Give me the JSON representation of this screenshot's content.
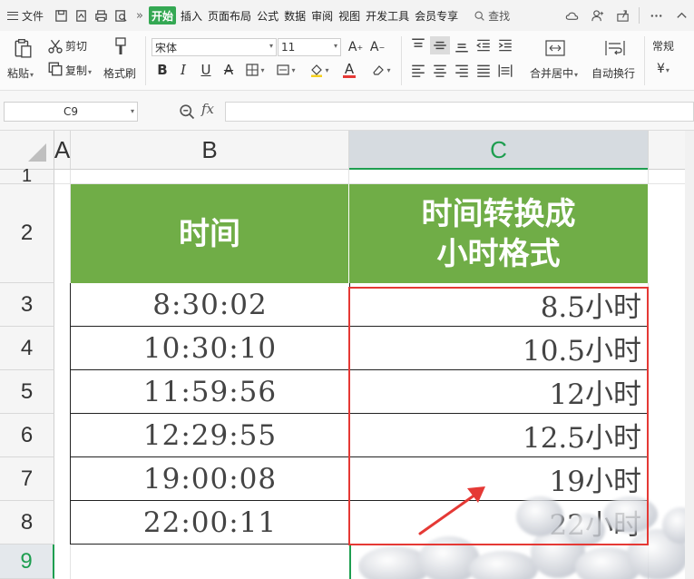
{
  "menubar": {
    "file_label": "文件",
    "tabs": [
      "开始",
      "插入",
      "页面布局",
      "公式",
      "数据",
      "审阅",
      "视图",
      "开发工具",
      "会员专享"
    ],
    "search_label": "查找",
    "more_glyph": "»"
  },
  "ribbon": {
    "paste": "粘贴",
    "cut": "剪切",
    "copy": "复制",
    "format_painter": "格式刷",
    "font_name": "宋体",
    "font_size": "11",
    "merge_center": "合并居中",
    "wrap_text": "自动换行",
    "number_format": "常规",
    "currency_symbol": "¥"
  },
  "formula_bar": {
    "name_box": "C9",
    "fx": "fx",
    "formula": ""
  },
  "sheet": {
    "col_headers": [
      "A",
      "B",
      "C"
    ],
    "row_headers": [
      "1",
      "2",
      "3",
      "4",
      "5",
      "6",
      "7",
      "8",
      "9"
    ],
    "header_b": "时间",
    "header_c_line1": "时间转换成",
    "header_c_line2": "小时格式",
    "rows": [
      {
        "time": "8:30:02",
        "hours": "8.5小时"
      },
      {
        "time": "10:30:10",
        "hours": "10.5小时"
      },
      {
        "time": "11:59:56",
        "hours": "12小时"
      },
      {
        "time": "12:29:55",
        "hours": "12.5小时"
      },
      {
        "time": "19:00:08",
        "hours": "19小时"
      },
      {
        "time": "22:00:11",
        "hours": "22小时"
      }
    ]
  },
  "colors": {
    "header_green": "#70ad47",
    "active_green": "#1e9e50",
    "annotation_red": "#e53935"
  }
}
